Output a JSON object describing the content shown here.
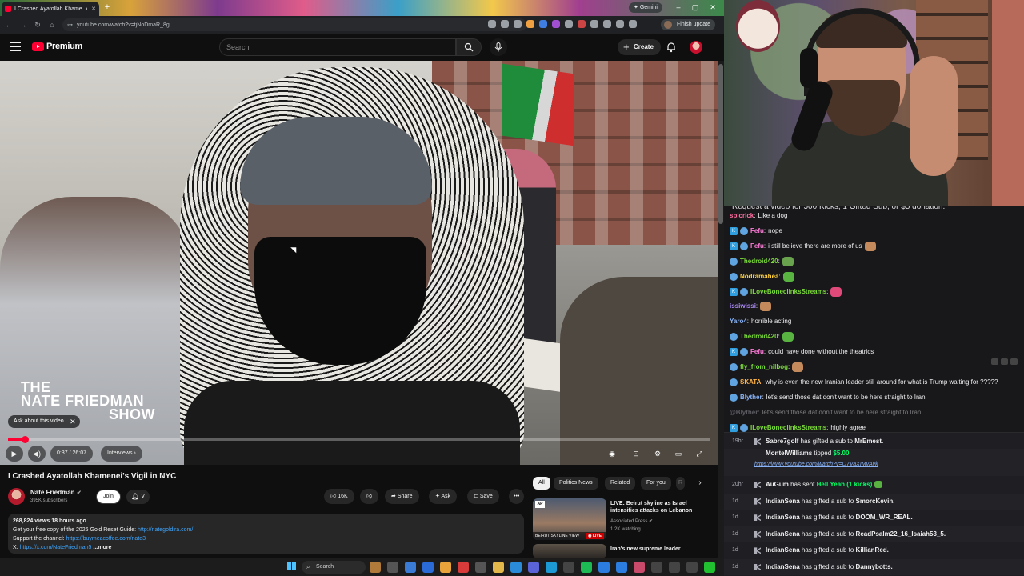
{
  "browser": {
    "tab_title": "I Crashed Ayatollah Khame",
    "url": "youtube.com/watch?v=tjNoDmaR_8g",
    "gemini_label": "Gemini",
    "finish_update_label": "Finish update"
  },
  "youtube": {
    "brand": "Premium",
    "search_placeholder": "Search",
    "create_label": "Create"
  },
  "player": {
    "show_logo": [
      "THE",
      "NATE FRIEDMAN",
      "SHOW"
    ],
    "ask_chip": "Ask about this video",
    "time": "0:37 / 26:07",
    "chapter": "Interviews",
    "progress": 0.024
  },
  "video": {
    "title": "I Crashed Ayatollah Khamenei's Vigil in NYC",
    "channel": "Nate Friedman",
    "subscribers": "395K subscribers",
    "join_label": "Join",
    "likes": "16K",
    "share_label": "Share",
    "ask_label": "Ask",
    "save_label": "Save"
  },
  "description": {
    "meta": "268,824 views  18 hours ago",
    "line1_text": "Get your free copy of the 2026 Gold Reset Guide: ",
    "line1_link": "http://nategoldira.com/",
    "line2_text": "Support the channel: ",
    "line2_link": "https://buymeacoffee.com/nate3",
    "line3_text": "X: ",
    "line3_link": "https://x.com/NateFriedman5",
    "more": "...more"
  },
  "related": {
    "chips": [
      "All",
      "Politics News",
      "Related",
      "For you",
      "R"
    ],
    "items": [
      {
        "title": "LIVE: Beirut skyline as Israel intensifies attacks on Lebanon",
        "channel": "Associated Press",
        "meta": "1.2K watching",
        "thumb_caption": "BEIRUT SKYLINE VIEW",
        "badge": "LIVE",
        "logo": "AP"
      },
      {
        "title": "Iran's new supreme leader",
        "channel": "",
        "meta": "",
        "thumb_caption": "",
        "badge": "",
        "logo": ""
      }
    ]
  },
  "taskbar": {
    "search_label": "Search"
  },
  "chat": {
    "banner": "Request a video for 500 Kicks, 1 Gifted Sub, or $5 donation.",
    "messages": [
      {
        "user": "spicrick",
        "text": "Like a dog",
        "color": "#ff6b9e",
        "badges": 0,
        "faded": false
      },
      {
        "user": "Fefu",
        "text": "nope",
        "color": "#ff7ad9",
        "badges": 2,
        "faded": false
      },
      {
        "user": "Fefu",
        "text": "i still believe there are more of us",
        "color": "#ff7ad9",
        "badges": 2,
        "faded": false
      },
      {
        "user": "Thedroid420",
        "text": "",
        "color": "#7cdc3a",
        "badges": 1,
        "faded": false
      },
      {
        "user": "Nodramahea",
        "text": "",
        "color": "#ffd23f",
        "badges": 1,
        "faded": false
      },
      {
        "user": "ILoveBoneclinksStreams",
        "text": "",
        "color": "#7cdc3a",
        "badges": 2,
        "faded": false
      },
      {
        "user": "issiwissi",
        "text": "",
        "color": "#b08cff",
        "badges": 0,
        "faded": false
      },
      {
        "user": "Yaro4",
        "text": "horrible acting",
        "color": "#8ab4f8",
        "badges": 0,
        "faded": false
      },
      {
        "user": "Thedroid420",
        "text": "",
        "color": "#7cdc3a",
        "badges": 1,
        "faded": false
      },
      {
        "user": "Fefu",
        "text": "could have done without the theatrics",
        "color": "#ff7ad9",
        "badges": 2,
        "faded": false
      },
      {
        "user": "fly_from_nilbog",
        "text": "",
        "color": "#7cdc3a",
        "badges": 1,
        "faded": false
      },
      {
        "user": "SKATA",
        "text": "why is even the new Iranian leader still around for what is Trump waiting for ?????",
        "color": "#ffb347",
        "badges": 1,
        "faded": false
      },
      {
        "user": "Blyther",
        "text": "let's send those dat don't want to be here straight to Iran.",
        "color": "#8ab4f8",
        "badges": 1,
        "faded": false
      },
      {
        "user": "@Blyther",
        "text": "let's send those dat don't want to be here straight to Iran.",
        "color": "#adadb8",
        "badges": 0,
        "faded": true
      },
      {
        "user": "ILoveBoneclinksStreams",
        "text": "highly agree",
        "color": "#7cdc3a",
        "badges": 2,
        "faded": false
      }
    ]
  },
  "events": [
    {
      "time": "19hr",
      "user": "Sabre7golf",
      "text": "has gifted a sub to",
      "target": "MrEmest.",
      "amount": "",
      "link": ""
    },
    {
      "time": "",
      "user": "MontelWilliams",
      "text": "tipped",
      "target": "",
      "amount": "$5.00",
      "link": "https://www.youtube.com/watch?v=O7VaXIMyAvk"
    },
    {
      "time": "20hr",
      "user": "AuGum",
      "text": "has sent",
      "target": "",
      "amount": "Hell Yeah (1 kicks)",
      "link": ""
    },
    {
      "time": "1d",
      "user": "IndianSena",
      "text": "has gifted a sub to",
      "target": "SmorcKevin.",
      "amount": "",
      "link": ""
    },
    {
      "time": "1d",
      "user": "IndianSena",
      "text": "has gifted a sub to",
      "target": "DOOM_WR_REAL.",
      "amount": "",
      "link": ""
    },
    {
      "time": "1d",
      "user": "IndianSena",
      "text": "has gifted a sub to",
      "target": "ReadPsalm22_16_Isaiah53_5.",
      "amount": "",
      "link": ""
    },
    {
      "time": "1d",
      "user": "IndianSena",
      "text": "has gifted a sub to",
      "target": "KillianRed.",
      "amount": "",
      "link": ""
    },
    {
      "time": "1d",
      "user": "IndianSena",
      "text": "has gifted a sub to",
      "target": "Dannybotts.",
      "amount": "",
      "link": ""
    }
  ],
  "colors": {
    "youtube_red": "#ff0033",
    "link_blue": "#3ea6ff",
    "kick_green": "#00ff66"
  }
}
